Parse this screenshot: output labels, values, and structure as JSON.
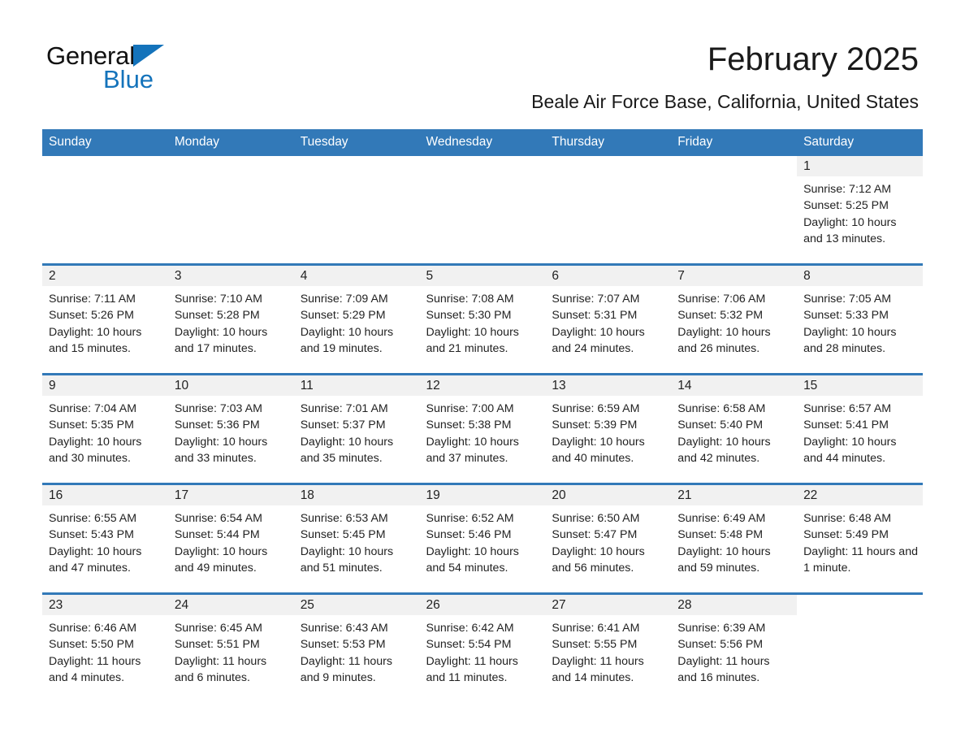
{
  "brand": {
    "name_part1": "General",
    "name_part2": "Blue",
    "triangle_color": "#1473bb"
  },
  "header": {
    "title": "February 2025",
    "subtitle": "Beale Air Force Base, California, United States"
  },
  "calendar": {
    "header_bg": "#3279b8",
    "daynum_bg": "#f1f1f1",
    "weekday_headers": [
      "Sunday",
      "Monday",
      "Tuesday",
      "Wednesday",
      "Thursday",
      "Friday",
      "Saturday"
    ],
    "weeks": [
      [
        {
          "day": "",
          "sunrise": "",
          "sunset": "",
          "daylight": "",
          "blank": true
        },
        {
          "day": "",
          "sunrise": "",
          "sunset": "",
          "daylight": "",
          "blank": true
        },
        {
          "day": "",
          "sunrise": "",
          "sunset": "",
          "daylight": "",
          "blank": true
        },
        {
          "day": "",
          "sunrise": "",
          "sunset": "",
          "daylight": "",
          "blank": true
        },
        {
          "day": "",
          "sunrise": "",
          "sunset": "",
          "daylight": "",
          "blank": true
        },
        {
          "day": "",
          "sunrise": "",
          "sunset": "",
          "daylight": "",
          "blank": true
        },
        {
          "day": "1",
          "sunrise": "Sunrise: 7:12 AM",
          "sunset": "Sunset: 5:25 PM",
          "daylight": "Daylight: 10 hours and 13 minutes."
        }
      ],
      [
        {
          "day": "2",
          "sunrise": "Sunrise: 7:11 AM",
          "sunset": "Sunset: 5:26 PM",
          "daylight": "Daylight: 10 hours and 15 minutes."
        },
        {
          "day": "3",
          "sunrise": "Sunrise: 7:10 AM",
          "sunset": "Sunset: 5:28 PM",
          "daylight": "Daylight: 10 hours and 17 minutes."
        },
        {
          "day": "4",
          "sunrise": "Sunrise: 7:09 AM",
          "sunset": "Sunset: 5:29 PM",
          "daylight": "Daylight: 10 hours and 19 minutes."
        },
        {
          "day": "5",
          "sunrise": "Sunrise: 7:08 AM",
          "sunset": "Sunset: 5:30 PM",
          "daylight": "Daylight: 10 hours and 21 minutes."
        },
        {
          "day": "6",
          "sunrise": "Sunrise: 7:07 AM",
          "sunset": "Sunset: 5:31 PM",
          "daylight": "Daylight: 10 hours and 24 minutes."
        },
        {
          "day": "7",
          "sunrise": "Sunrise: 7:06 AM",
          "sunset": "Sunset: 5:32 PM",
          "daylight": "Daylight: 10 hours and 26 minutes."
        },
        {
          "day": "8",
          "sunrise": "Sunrise: 7:05 AM",
          "sunset": "Sunset: 5:33 PM",
          "daylight": "Daylight: 10 hours and 28 minutes."
        }
      ],
      [
        {
          "day": "9",
          "sunrise": "Sunrise: 7:04 AM",
          "sunset": "Sunset: 5:35 PM",
          "daylight": "Daylight: 10 hours and 30 minutes."
        },
        {
          "day": "10",
          "sunrise": "Sunrise: 7:03 AM",
          "sunset": "Sunset: 5:36 PM",
          "daylight": "Daylight: 10 hours and 33 minutes."
        },
        {
          "day": "11",
          "sunrise": "Sunrise: 7:01 AM",
          "sunset": "Sunset: 5:37 PM",
          "daylight": "Daylight: 10 hours and 35 minutes."
        },
        {
          "day": "12",
          "sunrise": "Sunrise: 7:00 AM",
          "sunset": "Sunset: 5:38 PM",
          "daylight": "Daylight: 10 hours and 37 minutes."
        },
        {
          "day": "13",
          "sunrise": "Sunrise: 6:59 AM",
          "sunset": "Sunset: 5:39 PM",
          "daylight": "Daylight: 10 hours and 40 minutes."
        },
        {
          "day": "14",
          "sunrise": "Sunrise: 6:58 AM",
          "sunset": "Sunset: 5:40 PM",
          "daylight": "Daylight: 10 hours and 42 minutes."
        },
        {
          "day": "15",
          "sunrise": "Sunrise: 6:57 AM",
          "sunset": "Sunset: 5:41 PM",
          "daylight": "Daylight: 10 hours and 44 minutes."
        }
      ],
      [
        {
          "day": "16",
          "sunrise": "Sunrise: 6:55 AM",
          "sunset": "Sunset: 5:43 PM",
          "daylight": "Daylight: 10 hours and 47 minutes."
        },
        {
          "day": "17",
          "sunrise": "Sunrise: 6:54 AM",
          "sunset": "Sunset: 5:44 PM",
          "daylight": "Daylight: 10 hours and 49 minutes."
        },
        {
          "day": "18",
          "sunrise": "Sunrise: 6:53 AM",
          "sunset": "Sunset: 5:45 PM",
          "daylight": "Daylight: 10 hours and 51 minutes."
        },
        {
          "day": "19",
          "sunrise": "Sunrise: 6:52 AM",
          "sunset": "Sunset: 5:46 PM",
          "daylight": "Daylight: 10 hours and 54 minutes."
        },
        {
          "day": "20",
          "sunrise": "Sunrise: 6:50 AM",
          "sunset": "Sunset: 5:47 PM",
          "daylight": "Daylight: 10 hours and 56 minutes."
        },
        {
          "day": "21",
          "sunrise": "Sunrise: 6:49 AM",
          "sunset": "Sunset: 5:48 PM",
          "daylight": "Daylight: 10 hours and 59 minutes."
        },
        {
          "day": "22",
          "sunrise": "Sunrise: 6:48 AM",
          "sunset": "Sunset: 5:49 PM",
          "daylight": "Daylight: 11 hours and 1 minute."
        }
      ],
      [
        {
          "day": "23",
          "sunrise": "Sunrise: 6:46 AM",
          "sunset": "Sunset: 5:50 PM",
          "daylight": "Daylight: 11 hours and 4 minutes."
        },
        {
          "day": "24",
          "sunrise": "Sunrise: 6:45 AM",
          "sunset": "Sunset: 5:51 PM",
          "daylight": "Daylight: 11 hours and 6 minutes."
        },
        {
          "day": "25",
          "sunrise": "Sunrise: 6:43 AM",
          "sunset": "Sunset: 5:53 PM",
          "daylight": "Daylight: 11 hours and 9 minutes."
        },
        {
          "day": "26",
          "sunrise": "Sunrise: 6:42 AM",
          "sunset": "Sunset: 5:54 PM",
          "daylight": "Daylight: 11 hours and 11 minutes."
        },
        {
          "day": "27",
          "sunrise": "Sunrise: 6:41 AM",
          "sunset": "Sunset: 5:55 PM",
          "daylight": "Daylight: 11 hours and 14 minutes."
        },
        {
          "day": "28",
          "sunrise": "Sunrise: 6:39 AM",
          "sunset": "Sunset: 5:56 PM",
          "daylight": "Daylight: 11 hours and 16 minutes."
        },
        {
          "day": "",
          "sunrise": "",
          "sunset": "",
          "daylight": "",
          "blank": true
        }
      ]
    ]
  }
}
